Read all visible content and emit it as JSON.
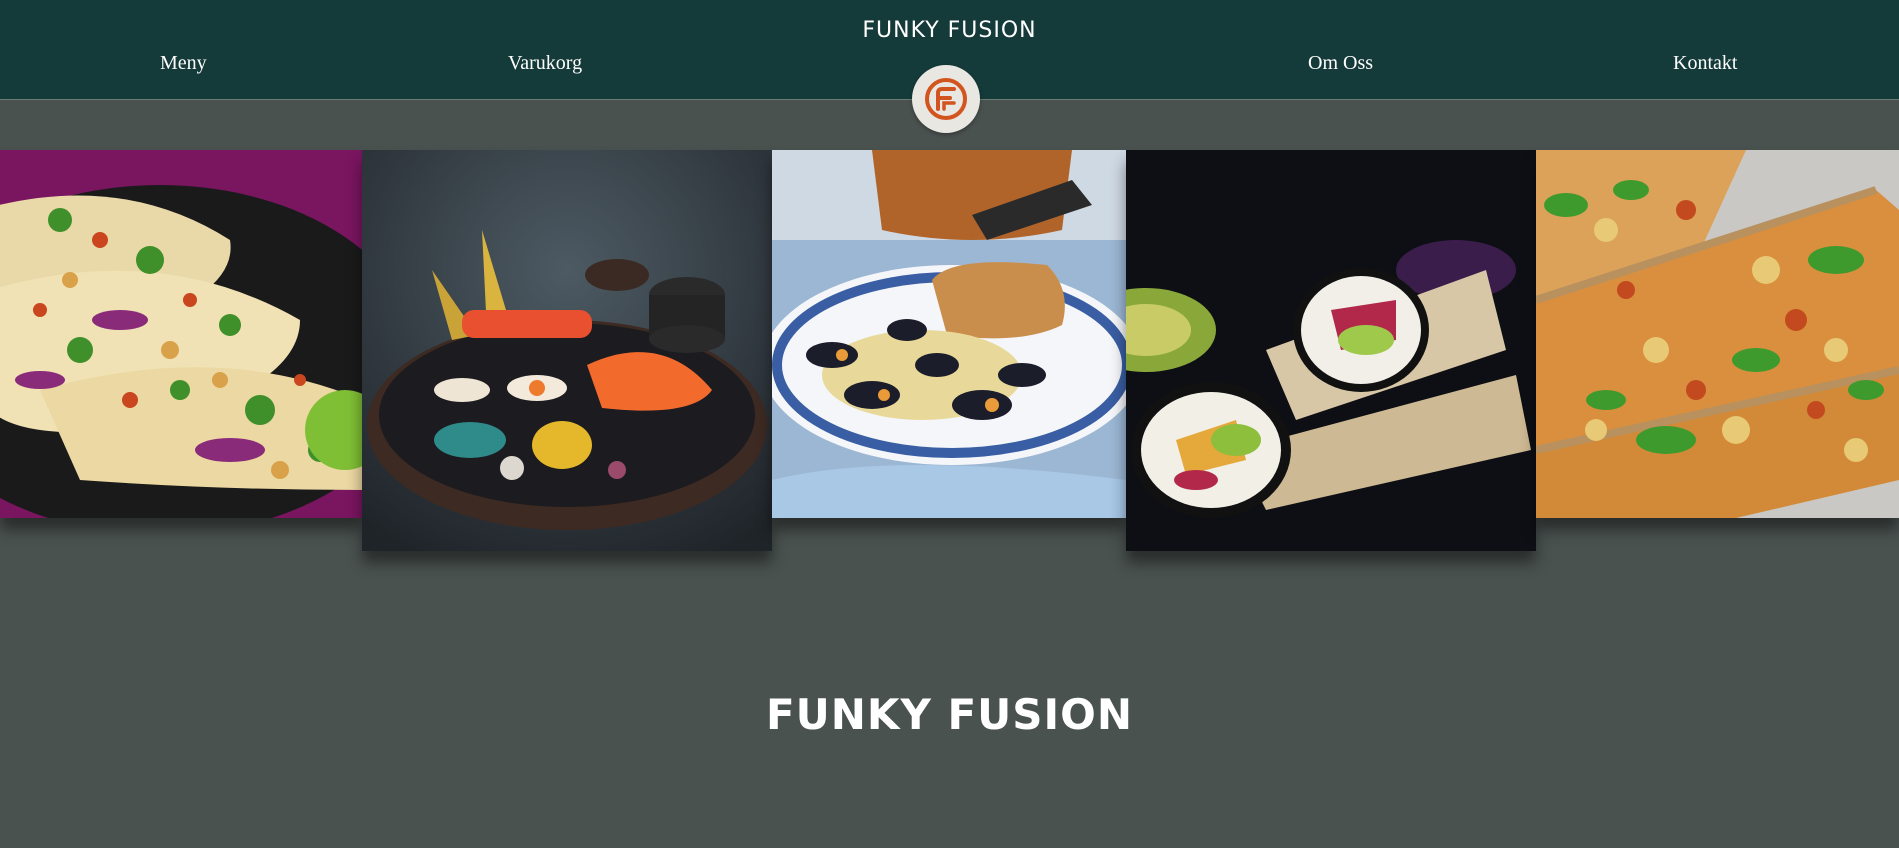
{
  "nav": {
    "menu": "Meny",
    "cart": "Varukorg",
    "about": "Om Oss",
    "contact": "Kontakt"
  },
  "brand": {
    "name_top": "FUNKY FUSION",
    "logo_icon": "ff-monogram-icon",
    "name_bottom": "FUNKY FUSION"
  },
  "colors": {
    "header_bg": "#143a39",
    "page_bg": "#4a5250",
    "logo_accent": "#d2541e",
    "logo_bg": "#e9e7e1"
  },
  "gallery": {
    "images": [
      "tacos-photo",
      "sushi-photo",
      "mussels-pasta-photo",
      "sushi-burrito-photo",
      "pizza-photo"
    ]
  }
}
